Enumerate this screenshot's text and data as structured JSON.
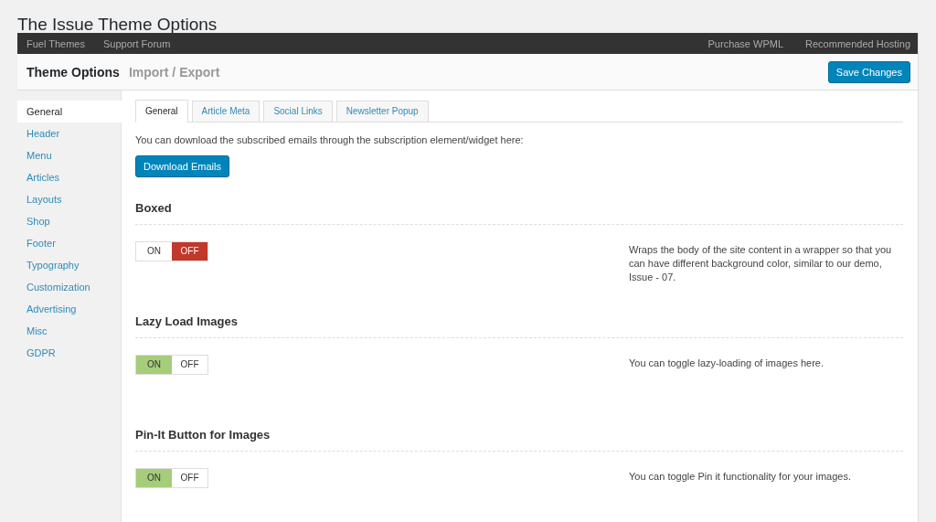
{
  "page_title": "The Issue Theme Options",
  "top_bar": {
    "left_links": [
      "Fuel Themes",
      "Support Forum"
    ],
    "right_links": [
      "Purchase WPML",
      "Recommended Hosting"
    ]
  },
  "header": {
    "tabs": [
      {
        "label": "Theme Options",
        "selected": true
      },
      {
        "label": "Import / Export",
        "selected": false
      }
    ],
    "save_button": "Save Changes"
  },
  "sidebar": {
    "items": [
      {
        "label": "General",
        "selected": true
      },
      {
        "label": "Header",
        "selected": false
      },
      {
        "label": "Menu",
        "selected": false
      },
      {
        "label": "Articles",
        "selected": false
      },
      {
        "label": "Layouts",
        "selected": false
      },
      {
        "label": "Shop",
        "selected": false
      },
      {
        "label": "Footer",
        "selected": false
      },
      {
        "label": "Typography",
        "selected": false
      },
      {
        "label": "Customization",
        "selected": false
      },
      {
        "label": "Advertising",
        "selected": false
      },
      {
        "label": "Misc",
        "selected": false
      },
      {
        "label": "GDPR",
        "selected": false
      }
    ]
  },
  "tabs": [
    {
      "label": "General",
      "selected": true
    },
    {
      "label": "Article Meta",
      "selected": false
    },
    {
      "label": "Social Links",
      "selected": false
    },
    {
      "label": "Newsletter Popup",
      "selected": false
    }
  ],
  "intro": "You can download the subscribed emails through the subscription element/widget here:",
  "download_button": "Download Emails",
  "options": [
    {
      "title": "Boxed",
      "on_label": "ON",
      "off_label": "OFF",
      "on": false,
      "description": "Wraps the body of the site content in a wrapper so that you can have different background color, similar to our demo, Issue - 07."
    },
    {
      "title": "Lazy Load Images",
      "on_label": "ON",
      "off_label": "OFF",
      "on": true,
      "description": "You can toggle lazy-loading of images here."
    },
    {
      "title": "Pin-It Button for Images",
      "on_label": "ON",
      "off_label": "OFF",
      "on": true,
      "description": "You can toggle Pin it functionality for your images."
    }
  ]
}
